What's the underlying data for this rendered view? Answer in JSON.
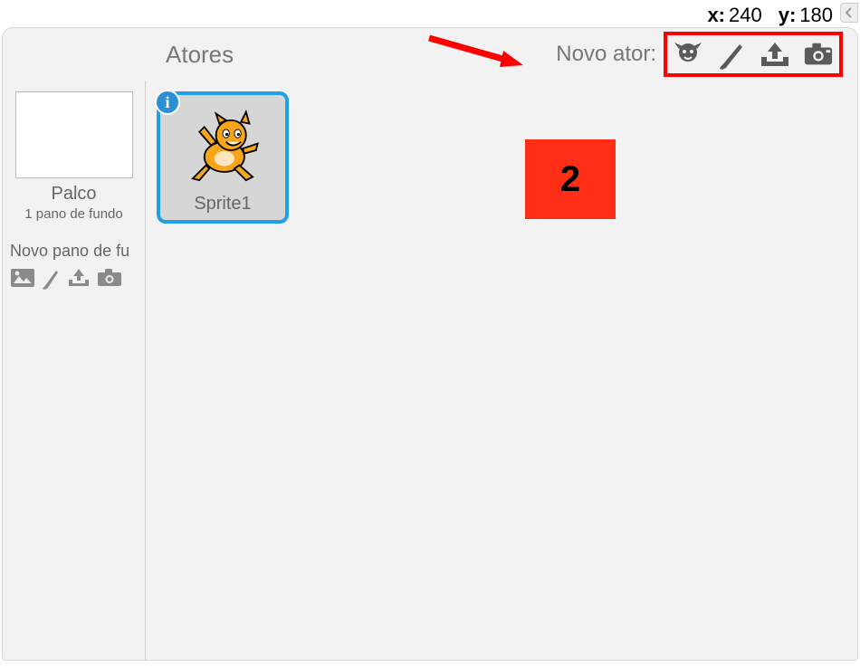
{
  "coords": {
    "x_label": "x:",
    "x_value": "240",
    "y_label": "y:",
    "y_value": "180"
  },
  "header": {
    "tab_label": "Atores",
    "new_sprite_label": "Novo ator:"
  },
  "toolbar_icons": {
    "library": "sprite-library-icon",
    "paint": "paintbrush-icon",
    "upload": "upload-icon",
    "camera": "camera-icon"
  },
  "sidebar": {
    "stage_label": "Palco",
    "backdrop_count": "1 pano de fundo",
    "new_backdrop_label": "Novo pano de fu",
    "bd_icons": {
      "image": "image-icon",
      "paint": "paintbrush-icon",
      "upload": "upload-icon",
      "camera": "camera-icon"
    }
  },
  "sprites": [
    {
      "name": "Sprite1",
      "info_glyph": "i"
    }
  ],
  "annotations": {
    "callout_number": "2"
  }
}
